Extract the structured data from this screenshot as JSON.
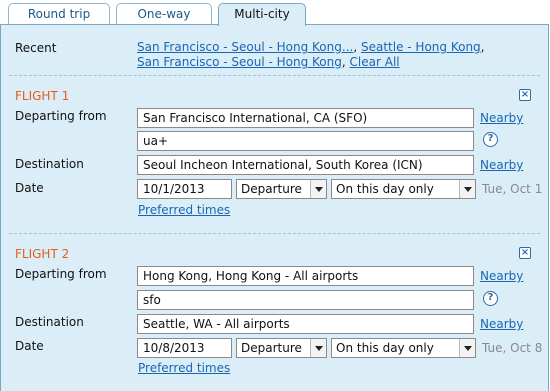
{
  "tabs": [
    {
      "label": "Round trip"
    },
    {
      "label": "One-way"
    },
    {
      "label": "Multi-city"
    }
  ],
  "recent": {
    "label": "Recent",
    "items": [
      "San Francisco - Seoul - Hong Kong...",
      "Seattle - Hong Kong",
      "San Francisco - Seoul - Hong Kong"
    ],
    "separator": ",",
    "clear_label": "Clear All"
  },
  "flights": [
    {
      "title": "FLIGHT 1",
      "departing_label": "Departing from",
      "departing_value": "San Francisco International, CA (SFO)",
      "nearby_label": "Nearby",
      "airline_value": "ua+",
      "destination_label": "Destination",
      "destination_value": "Seoul Incheon International, South Korea (ICN)",
      "nearby2_label": "Nearby",
      "date_label": "Date",
      "date_value": "10/1/2013",
      "time_type": "Departure",
      "flex": "On this day only",
      "day_text": "Tue, Oct 1",
      "preferred_label": "Preferred times"
    },
    {
      "title": "FLIGHT 2",
      "departing_label": "Departing from",
      "departing_value": "Hong Kong, Hong Kong - All airports",
      "nearby_label": "Nearby",
      "airline_value": "sfo",
      "destination_label": "Destination",
      "destination_value": "Seattle, WA - All airports",
      "nearby2_label": "Nearby",
      "date_label": "Date",
      "date_value": "10/8/2013",
      "time_type": "Departure",
      "flex": "On this day only",
      "day_text": "Tue, Oct 8",
      "preferred_label": "Preferred times"
    }
  ],
  "icons": {
    "close": "close-icon",
    "help": "help-icon",
    "dropdown": "chevron-down-icon"
  },
  "colors": {
    "panel_bg": "#dbeef8",
    "link": "#1a66b3",
    "flight_title": "#e35d1c"
  }
}
